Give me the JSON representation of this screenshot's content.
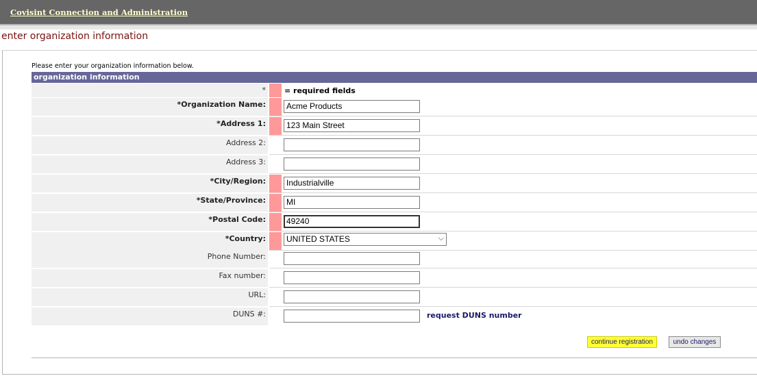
{
  "header": {
    "app_title": "Covisint Connection and Administration"
  },
  "page": {
    "title": "enter organization information",
    "intro": "Please enter your organization information below.",
    "section_title": "organization information",
    "required_marker": "*",
    "required_note": "= required fields"
  },
  "fields": {
    "org_name": {
      "label": "*Organization Name:",
      "value": "Acme Products"
    },
    "address1": {
      "label": "*Address 1:",
      "value": "123 Main Street"
    },
    "address2": {
      "label": "Address 2:",
      "value": ""
    },
    "address3": {
      "label": "Address 3:",
      "value": ""
    },
    "city": {
      "label": "*City/Region:",
      "value": "Industrialville"
    },
    "state": {
      "label": "*State/Province:",
      "value": "MI"
    },
    "postal": {
      "label": "*Postal Code:",
      "value": "49240"
    },
    "country": {
      "label": "*Country:",
      "value": "UNITED STATES"
    },
    "phone": {
      "label": "Phone Number:",
      "value": ""
    },
    "fax": {
      "label": "Fax number:",
      "value": ""
    },
    "url": {
      "label": "URL:",
      "value": ""
    },
    "duns": {
      "label": "DUNS #:",
      "value": "",
      "link": "request DUNS number"
    }
  },
  "buttons": {
    "continue": "continue registration",
    "undo": "undo changes"
  },
  "colors": {
    "header_bg": "#666666",
    "section_bg": "#666699",
    "required_marker": "#ff9999",
    "title": "#7a0f0f",
    "highlight": "#ffff33"
  }
}
